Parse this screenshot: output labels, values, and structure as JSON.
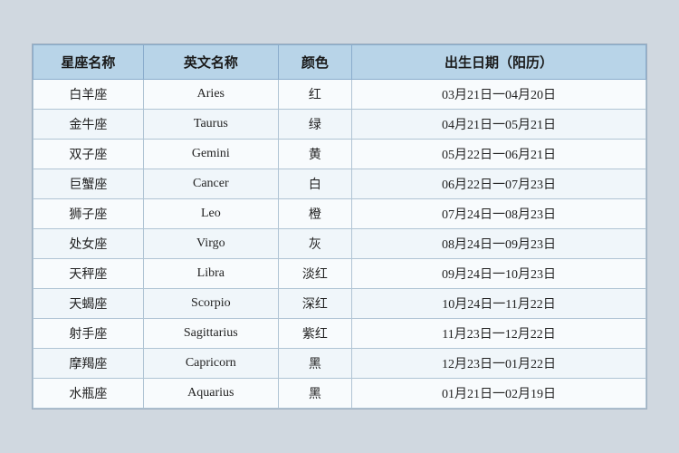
{
  "table": {
    "headers": [
      "星座名称",
      "英文名称",
      "颜色",
      "出生日期（阳历）"
    ],
    "rows": [
      {
        "zh": "白羊座",
        "en": "Aries",
        "color": "红",
        "date": "03月21日一04月20日"
      },
      {
        "zh": "金牛座",
        "en": "Taurus",
        "color": "绿",
        "date": "04月21日一05月21日"
      },
      {
        "zh": "双子座",
        "en": "Gemini",
        "color": "黄",
        "date": "05月22日一06月21日"
      },
      {
        "zh": "巨蟹座",
        "en": "Cancer",
        "color": "白",
        "date": "06月22日一07月23日"
      },
      {
        "zh": "狮子座",
        "en": "Leo",
        "color": "橙",
        "date": "07月24日一08月23日"
      },
      {
        "zh": "处女座",
        "en": "Virgo",
        "color": "灰",
        "date": "08月24日一09月23日"
      },
      {
        "zh": "天秤座",
        "en": "Libra",
        "color": "淡红",
        "date": "09月24日一10月23日"
      },
      {
        "zh": "天蝎座",
        "en": "Scorpio",
        "color": "深红",
        "date": "10月24日一11月22日"
      },
      {
        "zh": "射手座",
        "en": "Sagittarius",
        "color": "紫红",
        "date": "11月23日一12月22日"
      },
      {
        "zh": "摩羯座",
        "en": "Capricorn",
        "color": "黑",
        "date": "12月23日一01月22日"
      },
      {
        "zh": "水瓶座",
        "en": "Aquarius",
        "color": "黑",
        "date": "01月21日一02月19日"
      }
    ]
  }
}
